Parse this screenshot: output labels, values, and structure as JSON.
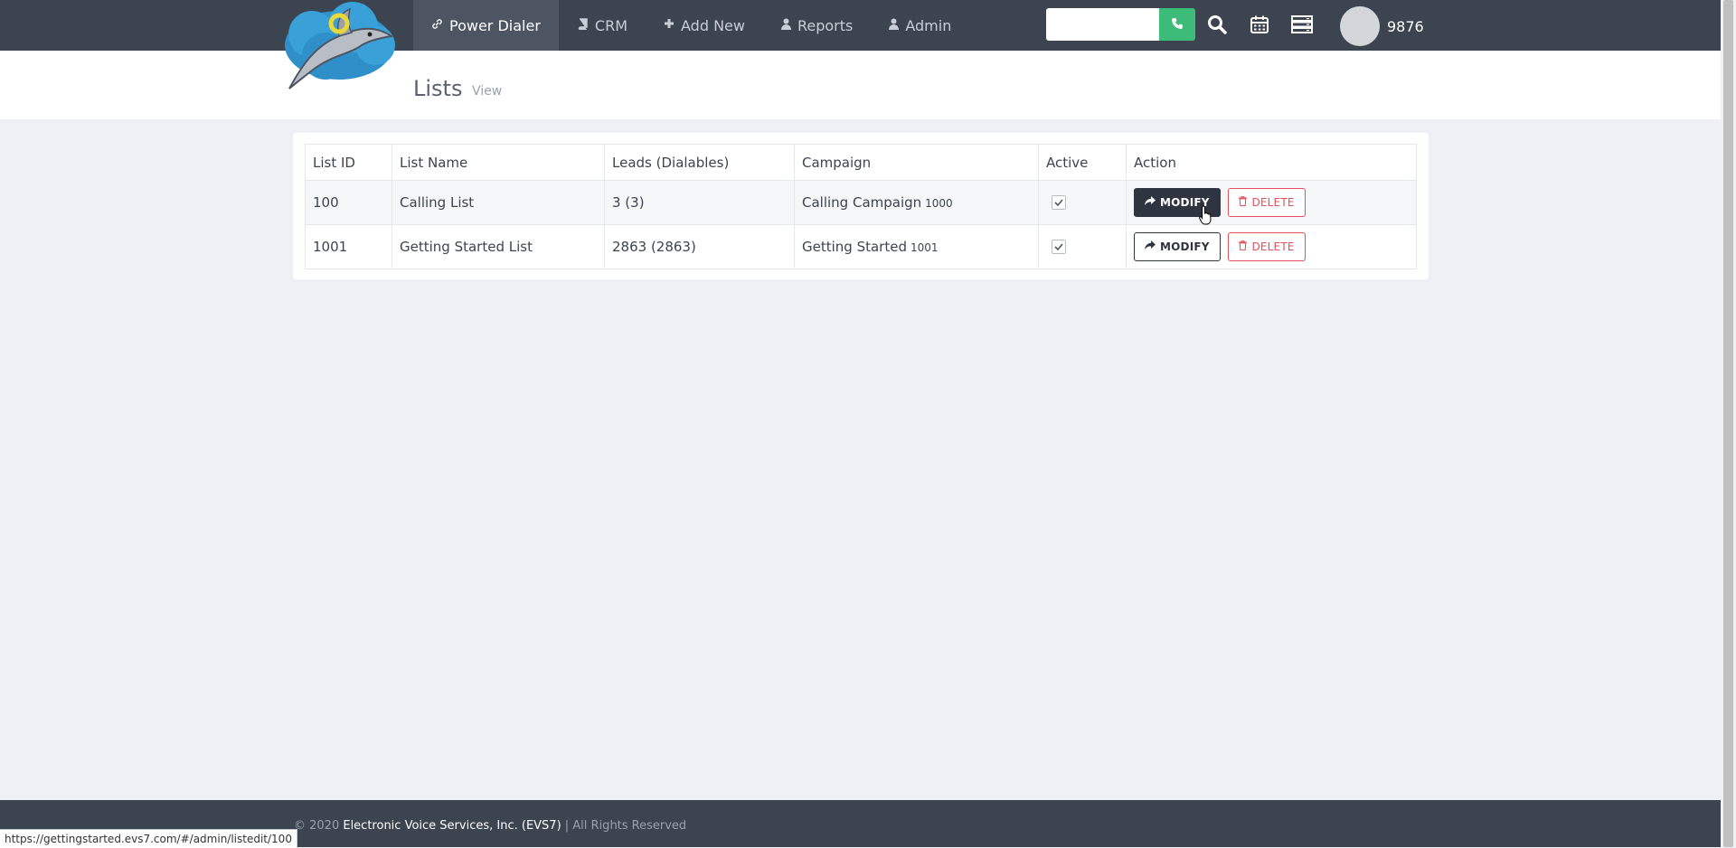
{
  "nav": {
    "items": [
      {
        "label": "Power Dialer",
        "icon": "link-icon",
        "active": true
      },
      {
        "label": "CRM",
        "icon": "book-icon",
        "active": false
      },
      {
        "label": "Add New",
        "icon": "plus-icon",
        "active": false
      },
      {
        "label": "Reports",
        "icon": "user-icon",
        "active": false
      },
      {
        "label": "Admin",
        "icon": "user-icon",
        "active": false
      }
    ],
    "dial_input": {
      "value": "",
      "placeholder": ""
    },
    "extension": "9876"
  },
  "page": {
    "title": "Lists",
    "subtitle": "View"
  },
  "table": {
    "columns": [
      "List ID",
      "List Name",
      "Leads (Dialables)",
      "Campaign",
      "Active",
      "Action"
    ],
    "rows": [
      {
        "list_id": "100",
        "list_name": "Calling List",
        "leads": "3 (3)",
        "campaign_name": "Calling Campaign",
        "campaign_id": "1000",
        "active": true
      },
      {
        "list_id": "1001",
        "list_name": "Getting Started List",
        "leads": "2863 (2863)",
        "campaign_name": "Getting Started",
        "campaign_id": "1001",
        "active": true
      }
    ],
    "modify_label": "MODIFY",
    "delete_label": "DELETE"
  },
  "footer": {
    "copyright": "© 2020",
    "company": "Electronic Voice Services, Inc. (EVS7)",
    "rights": "| All Rights Reserved"
  },
  "status_url": "https://gettingstarted.evs7.com/#/admin/listedit/100",
  "colors": {
    "topbar": "#3c4450",
    "call_button": "#3dbb78",
    "delete_red": "#e0525d",
    "background": "#edf0f5"
  }
}
